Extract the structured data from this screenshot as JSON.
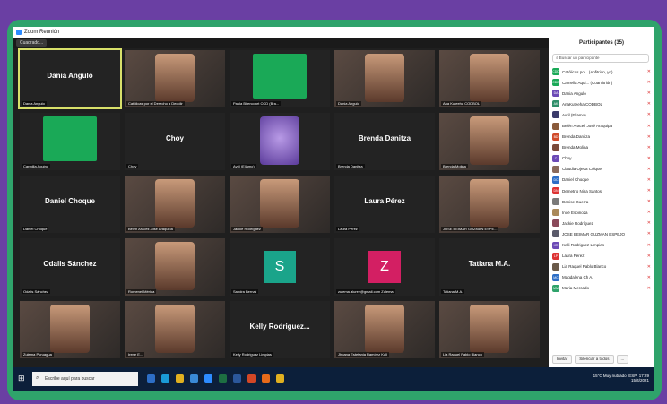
{
  "window": {
    "title": "Zoom Reunión",
    "view_button": "Cuadrado..."
  },
  "tiles": [
    {
      "name": "Dania Angulo",
      "caption": "Dania Angulo",
      "kind": "name",
      "speaking": true
    },
    {
      "name": "",
      "caption": "Católicas por el Derecho a Decidir",
      "kind": "photo"
    },
    {
      "name": "",
      "caption": "Paula Bitencourt CCD (Bra...",
      "kind": "cdd"
    },
    {
      "name": "",
      "caption": "Dania Angulo",
      "kind": "photo"
    },
    {
      "name": "",
      "caption": "Ana Kuteeha CODBOL",
      "kind": "photo"
    },
    {
      "name": "",
      "caption": "Carmilla Aquino",
      "kind": "cdd"
    },
    {
      "name": "Choy",
      "caption": "Choy",
      "kind": "name"
    },
    {
      "name": "",
      "caption": "Avril (Ellamo)",
      "kind": "alien"
    },
    {
      "name": "Brenda Danitza",
      "caption": "Brenda Danitza",
      "kind": "name"
    },
    {
      "name": "",
      "caption": "Brenda Molina",
      "kind": "photo"
    },
    {
      "name": "Daniel Choque",
      "caption": "Daniel Choque",
      "kind": "name"
    },
    {
      "name": "",
      "caption": "Belén Araceli José Araquipa",
      "kind": "photo"
    },
    {
      "name": "",
      "caption": "Jackie Rodríguez",
      "kind": "photo"
    },
    {
      "name": "Laura Pérez",
      "caption": "Laura Pérez",
      "kind": "name"
    },
    {
      "name": "",
      "caption": "JOSE BEIMAR GUZMAN ESPE...",
      "kind": "photo"
    },
    {
      "name": "Odalis Sánchez",
      "caption": "Odalis Sánchez",
      "kind": "name"
    },
    {
      "name": "",
      "caption": "Romenel Mérida",
      "kind": "photo"
    },
    {
      "name": "S",
      "caption": "Sandra Bernal",
      "kind": "letter",
      "color": "#1aa48a"
    },
    {
      "name": "Z",
      "caption": "zulema.alurez@gmail.com Zulema",
      "kind": "letter",
      "color": "#d31f63"
    },
    {
      "name": "Tatiana M.A.",
      "caption": "Tatiana M.A.",
      "kind": "name"
    },
    {
      "name": "",
      "caption": "Zulema Puruagua",
      "kind": "photo"
    },
    {
      "name": "",
      "caption": "Irene E...",
      "kind": "photo"
    },
    {
      "name": "Kelly Rodriguez...",
      "caption": "Kelly Rodriguez Limpias",
      "kind": "name"
    },
    {
      "name": "",
      "caption": "Jhoana Estefania Ramírez Kull",
      "kind": "photo"
    },
    {
      "name": "",
      "caption": "Lia Raquel Pablo Blanco",
      "kind": "photo"
    }
  ],
  "participants_panel": {
    "title": "Participantes (35)",
    "search_placeholder": "Buscar un participante",
    "participants": [
      {
        "name": "Católicas po... (Anfitrión, yo)",
        "badge": "CDD",
        "color": "#1aa957"
      },
      {
        "name": "Camella Aqui... (Coanfitrión)",
        "badge": "CDD",
        "color": "#1aa957"
      },
      {
        "name": "Dania Angulo",
        "badge": "DA",
        "color": "#6c4ab6"
      },
      {
        "name": "AnaKuteeha CODBOL",
        "badge": "AK",
        "color": "#2f8f6a"
      },
      {
        "name": "Avril (Ellamo)",
        "badge": "",
        "color": "#3a3a6a"
      },
      {
        "name": "Belén Araceli José Araquipa",
        "badge": "",
        "color": "#8a5a3a"
      },
      {
        "name": "Brenda Danitza",
        "badge": "BD",
        "color": "#d04a2a"
      },
      {
        "name": "Brenda Molina",
        "badge": "",
        "color": "#7a4a3a"
      },
      {
        "name": "Choy",
        "badge": "C",
        "color": "#6c4ab6"
      },
      {
        "name": "Claudia Ojeda Colque",
        "badge": "",
        "color": "#8a6a5a"
      },
      {
        "name": "Daniel Choque",
        "badge": "DC",
        "color": "#2d6ec6"
      },
      {
        "name": "Demetrio Nina Santos",
        "badge": "DN",
        "color": "#d33"
      },
      {
        "name": "Denise Guerra",
        "badge": "",
        "color": "#7a7a7a"
      },
      {
        "name": "Inoé Espinoza",
        "badge": "",
        "color": "#aa8a5a"
      },
      {
        "name": "Jackie Rodríguez",
        "badge": "",
        "color": "#8a4a5a"
      },
      {
        "name": "JOSE BEIMAR GUZMAN ESPEJO",
        "badge": "",
        "color": "#5a5a6a"
      },
      {
        "name": "Kelli Rodriguez Limpias",
        "badge": "KR",
        "color": "#6c4ab6"
      },
      {
        "name": "Laura Pérez",
        "badge": "LP",
        "color": "#d33"
      },
      {
        "name": "Lia Raquel Pablo Blanco",
        "badge": "",
        "color": "#6a5a4a"
      },
      {
        "name": "Magdalena Ch A.",
        "badge": "MC",
        "color": "#2d6ec6"
      },
      {
        "name": "Maria Mercado",
        "badge": "MM",
        "color": "#2fa36b"
      }
    ],
    "invite_button": "Invitar",
    "mute_all_button": "Silenciar a todos",
    "more_button": "..."
  },
  "taskbar": {
    "search_placeholder": "Escribe aquí para buscar",
    "weather": "15°C  Muy nublado",
    "lang": "ESP",
    "time": "17:29",
    "date": "15/4/2021"
  }
}
